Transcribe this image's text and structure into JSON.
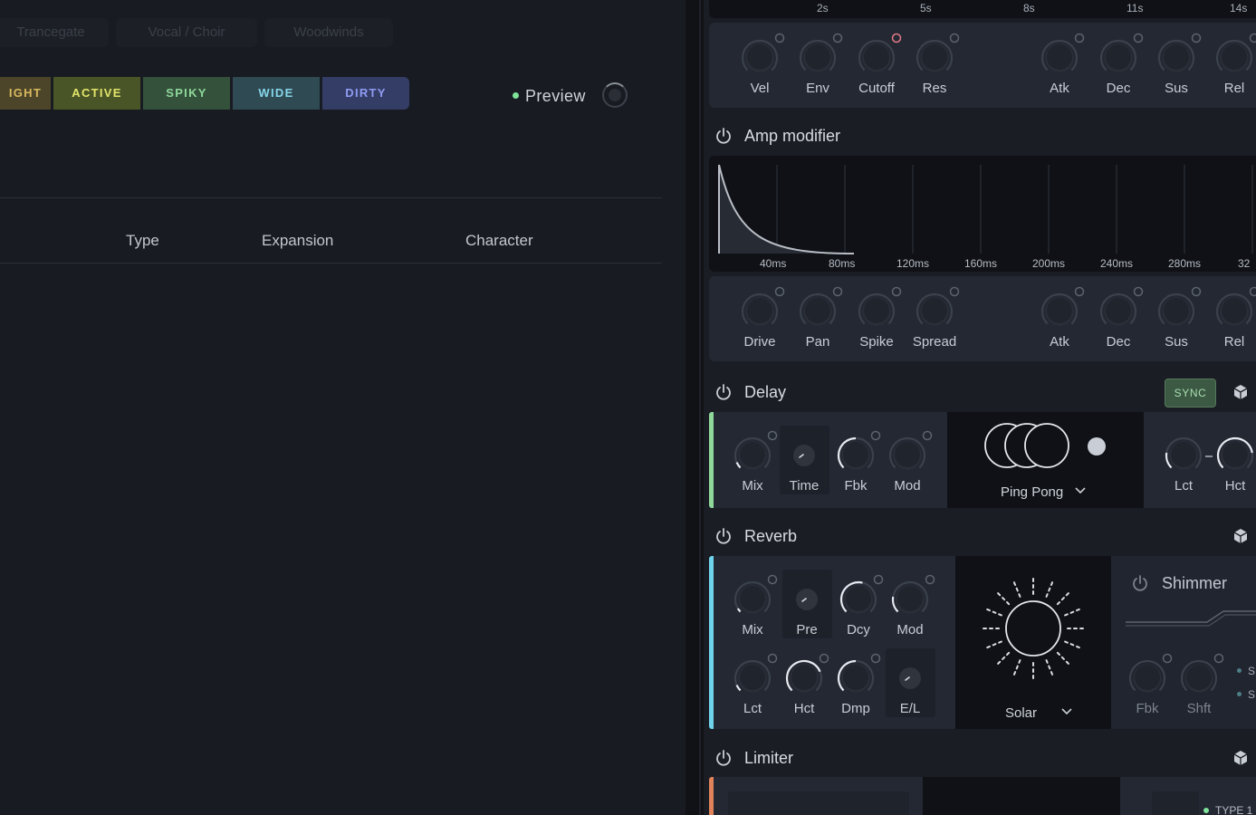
{
  "browser": {
    "categories": [
      "Trancegate",
      "Vocal / Choir",
      "Woodwinds"
    ],
    "tags": [
      {
        "label": "IGHT",
        "bg": "#4d4529",
        "fg": "#d9b95f"
      },
      {
        "label": "ACTIVE",
        "bg": "#4a5527",
        "fg": "#e3e56a"
      },
      {
        "label": "SPIKY",
        "bg": "#34513c",
        "fg": "#8fd89a"
      },
      {
        "label": "WIDE",
        "bg": "#2f4a52",
        "fg": "#86d6ea"
      },
      {
        "label": "DIRTY",
        "bg": "#343d66",
        "fg": "#8f9cf2"
      }
    ],
    "preview_label": "Preview",
    "columns": [
      "Type",
      "Expansion",
      "Character"
    ]
  },
  "fx": {
    "filter_env": {
      "time_ticks": [
        "2s",
        "5s",
        "8s",
        "11s",
        "14s"
      ],
      "knobs": [
        "Vel",
        "Env",
        "Cutoff",
        "Res",
        "Atk",
        "Dec",
        "Sus",
        "Rel"
      ]
    },
    "amp_modifier": {
      "title": "Amp modifier",
      "time_ticks": [
        "40ms",
        "80ms",
        "120ms",
        "160ms",
        "200ms",
        "240ms",
        "280ms",
        "32"
      ],
      "knobs": [
        "Drive",
        "Pan",
        "Spike",
        "Spread",
        "Atk",
        "Dec",
        "Sus",
        "Rel"
      ]
    },
    "delay": {
      "title": "Delay",
      "sync_label": "SYNC",
      "knobs": [
        "Mix",
        "Time",
        "Fbk",
        "Mod"
      ],
      "mode": "Ping Pong",
      "filter_knobs": [
        "Lct",
        "Hct"
      ],
      "accent": "#8fd89a"
    },
    "reverb": {
      "title": "Reverb",
      "knobs_row1": [
        "Mix",
        "Pre",
        "Dcy",
        "Mod"
      ],
      "knobs_row2": [
        "Lct",
        "Hct",
        "Dmp",
        "E/L"
      ],
      "mode": "Solar",
      "accent": "#6fd3ec",
      "shimmer": {
        "title": "Shimmer",
        "knobs": [
          "Fbk",
          "Shft"
        ],
        "options": [
          "S",
          "S"
        ]
      }
    },
    "limiter": {
      "title": "Limiter",
      "mode": "TYPE 1",
      "accent": "#e0825a"
    }
  }
}
